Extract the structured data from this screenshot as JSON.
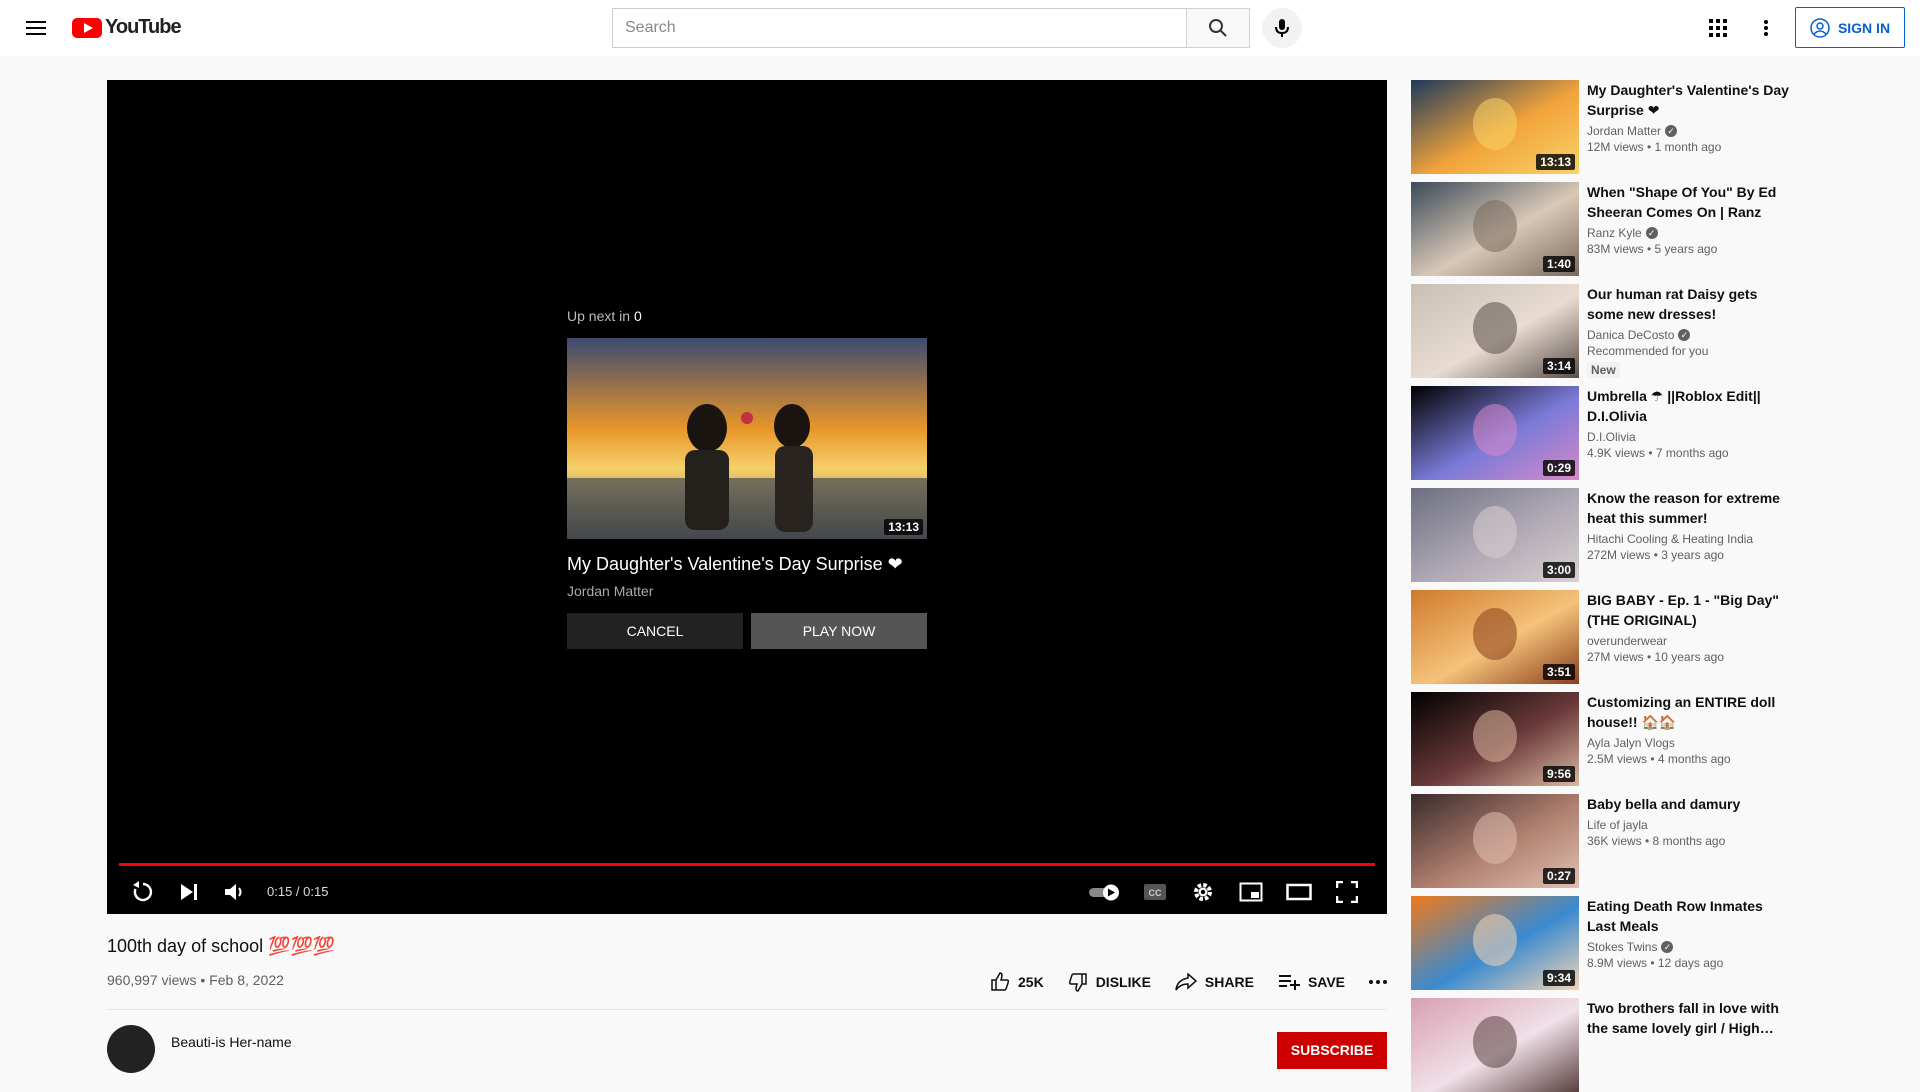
{
  "header": {
    "logo_text": "YouTube",
    "search_placeholder": "Search",
    "signin_label": "SIGN IN"
  },
  "player": {
    "upnext_prefix": "Up next in",
    "upnext_count": "0",
    "upnext_title": "My Daughter's Valentine's Day Surprise ❤",
    "upnext_channel": "Jordan Matter",
    "upnext_duration": "13:13",
    "cancel_label": "CANCEL",
    "play_label": "PLAY NOW",
    "time": "0:15 / 0:15",
    "progress": 1.0
  },
  "video": {
    "title": "100th day of school 💯💯💯",
    "meta": "960,997 views • Feb 8, 2022",
    "like_count": "25K",
    "dislike_label": "DISLIKE",
    "share_label": "SHARE",
    "save_label": "SAVE",
    "channel_name": "Beauti-is Her-name",
    "subscribe_label": "SUBSCRIBE"
  },
  "sidebar": [
    {
      "title": "My Daughter's Valentine's Day Surprise ❤",
      "channel": "Jordan Matter",
      "verified": true,
      "views": "12M views • 1 month ago",
      "duration": "13:13",
      "colors": [
        "#1d3a5c",
        "#f2a33a",
        "#f7d36a"
      ]
    },
    {
      "title": "When \"Shape Of You\" By Ed Sheeran Comes On | Ranz and…",
      "channel": "Ranz Kyle",
      "verified": true,
      "views": "83M views • 5 years ago",
      "duration": "1:40",
      "colors": [
        "#3b4a5a",
        "#d9c8b6",
        "#7a6a5c"
      ]
    },
    {
      "title": "Our human rat Daisy gets some new dresses!",
      "channel": "Danica DeCosto",
      "verified": true,
      "views": "Recommended for you",
      "duration": "3:14",
      "badge": "New",
      "colors": [
        "#c9bfb4",
        "#e8dcd2",
        "#5a4f48"
      ]
    },
    {
      "title": "Umbrella ☂ ||Roblox Edit|| D.I.Olivia",
      "channel": "D.I.Olivia",
      "verified": false,
      "views": "4.9K views • 7 months ago",
      "duration": "0:29",
      "colors": [
        "#000000",
        "#7a7ad8",
        "#d889c9"
      ]
    },
    {
      "title": "Know the reason for extreme heat this summer! #WhoIsSuraj",
      "channel": "Hitachi Cooling & Heating India",
      "verified": false,
      "views": "272M views • 3 years ago",
      "duration": "3:00",
      "colors": [
        "#6c6f80",
        "#b0a9b5",
        "#d8d0d0"
      ]
    },
    {
      "title": "BIG BABY - Ep. 1 - \"Big Day\" (THE ORIGINAL)",
      "channel": "overunderwear",
      "verified": false,
      "views": "27M views • 10 years ago",
      "duration": "3:51",
      "colors": [
        "#d07a2c",
        "#f4c27a",
        "#8a3e1a"
      ]
    },
    {
      "title": "Customizing an ENTIRE doll house!! 🏠🏠",
      "channel": "Ayla Jalyn Vlogs",
      "verified": false,
      "views": "2.5M views • 4 months ago",
      "duration": "9:56",
      "colors": [
        "#000000",
        "#6b3a3a",
        "#d9b8a0"
      ]
    },
    {
      "title": "Baby bella and damury",
      "channel": "Life of jayla",
      "verified": false,
      "views": "36K views • 8 months ago",
      "duration": "0:27",
      "colors": [
        "#3a2a2a",
        "#b08070",
        "#e0c0b0"
      ]
    },
    {
      "title": "Eating Death Row Inmates Last Meals",
      "channel": "Stokes Twins",
      "verified": true,
      "views": "8.9M views • 12 days ago",
      "duration": "9:34",
      "colors": [
        "#f07a1a",
        "#3a8ad0",
        "#f5d5b5"
      ]
    },
    {
      "title": "Two brothers fall in love with the same lovely girl / High…",
      "channel": "",
      "verified": false,
      "views": "",
      "duration": "",
      "colors": [
        "#d8a0b0",
        "#f0e0e8",
        "#5a4040"
      ]
    }
  ]
}
